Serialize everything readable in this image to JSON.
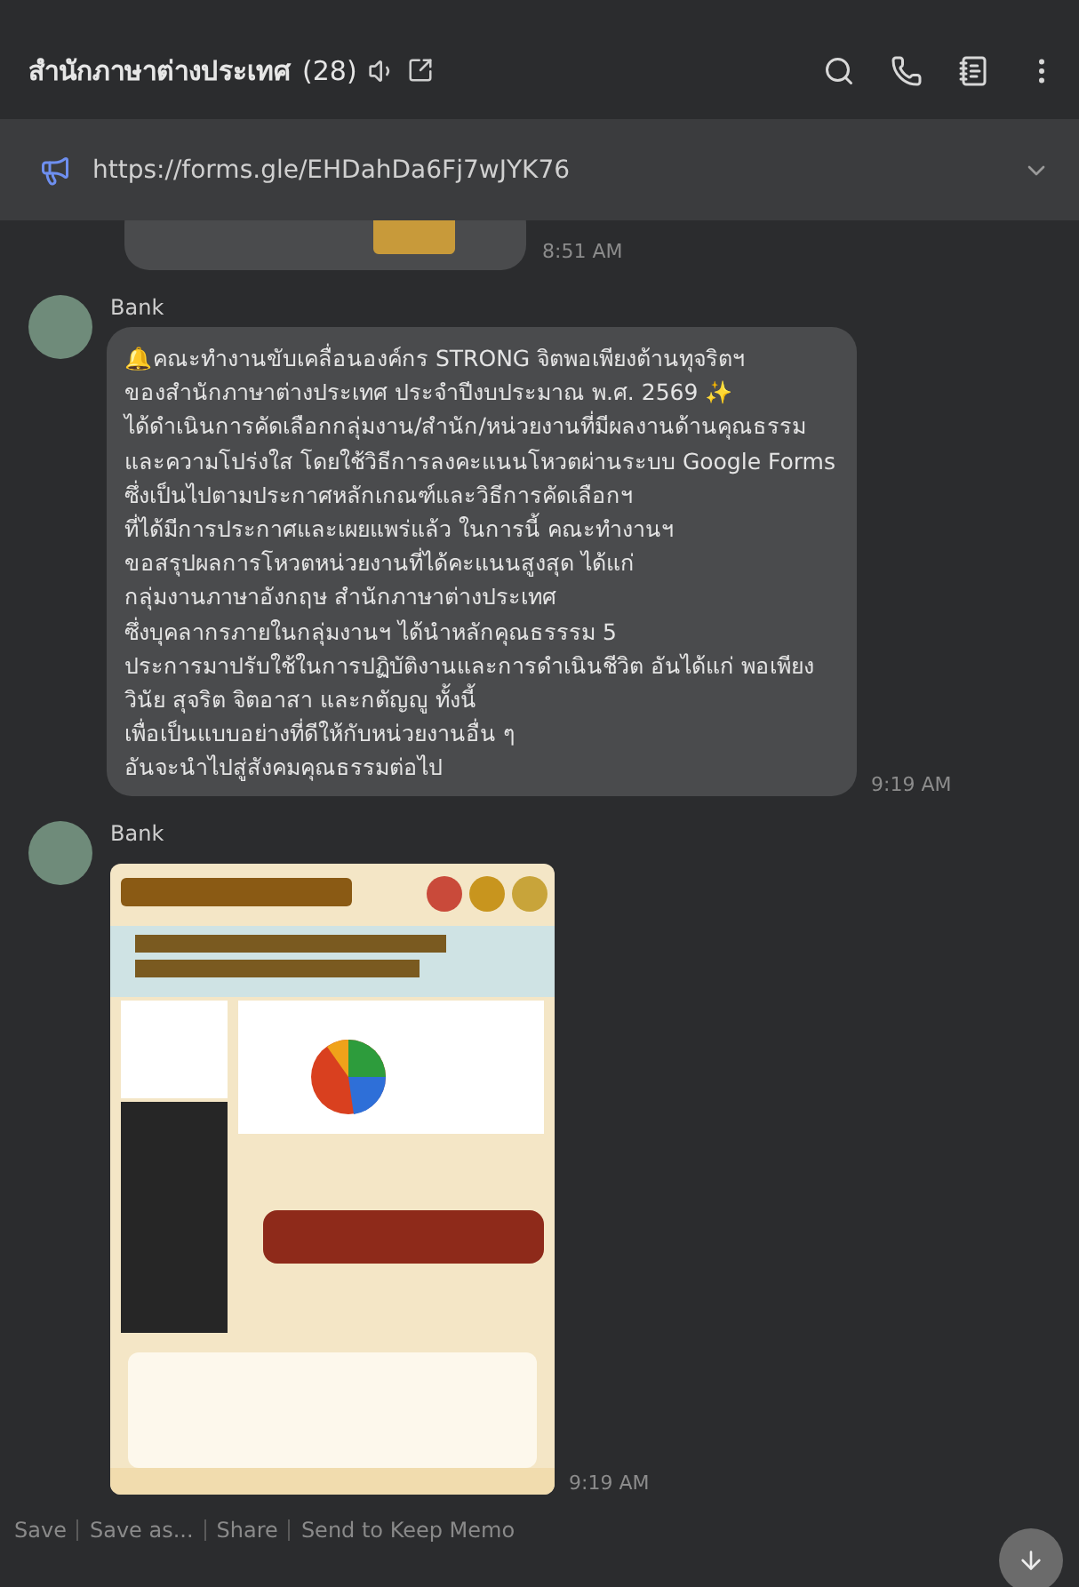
{
  "header": {
    "title": "สำนักภาษาต่างประเทศ",
    "member_count": "(28)"
  },
  "pinned": {
    "url": "https://forms.gle/EHDahDa6Fj7wJYK76"
  },
  "messages": [
    {
      "kind": "partial",
      "time": "8:51 AM"
    },
    {
      "kind": "text",
      "sender": "Bank",
      "text": "🔔คณะทำงานขับเคลื่อนองค์กร STRONG จิตพอเพียงต้านทุจริตฯ\nของสำนักภาษาต่างประเทศ ประจำปีงบประมาณ พ.ศ. 2569 ✨\nได้ดำเนินการคัดเลือกกลุ่มงาน/สำนัก/หน่วยงานที่มีผลงานด้านคุณธรรม\nและความโปร่งใส โดยใช้วิธีการลงคะแนนโหวตผ่านระบบ Google Forms\nซึ่งเป็นไปตามประกาศหลักเกณฑ์และวิธีการคัดเลือกฯ\nที่ได้มีการประกาศและเผยแพร่แล้ว ในการนี้ คณะทำงานฯ\nขอสรุปผลการโหวตหน่วยงานที่ได้คะแนนสูงสุด ได้แก่\nกลุ่มงานภาษาอังกฤษ สำนักภาษาต่างประเทศ\nซึ่งบุคลากรภายในกลุ่มงานฯ ได้นำหลักคุณธรรรม 5\nประการมาปรับใช้ในการปฏิบัติงานและการดำเนินชีวิต อันได้แก่ พอเพียง\nวินัย สุจริต จิตอาสา และกตัญญู ทั้งนี้\nเพื่อเป็นแบบอย่างที่ดีให้กับหน่วยงานอื่น ๆ\nอันจะนำไปสู่สังคมคุณธรรมต่อไป",
      "time": "9:19 AM"
    },
    {
      "kind": "image",
      "sender": "Bank",
      "time": "9:19 AM",
      "actions": [
        "Save",
        "Save as...",
        "Share",
        "Send to Keep Memo"
      ]
    }
  ]
}
